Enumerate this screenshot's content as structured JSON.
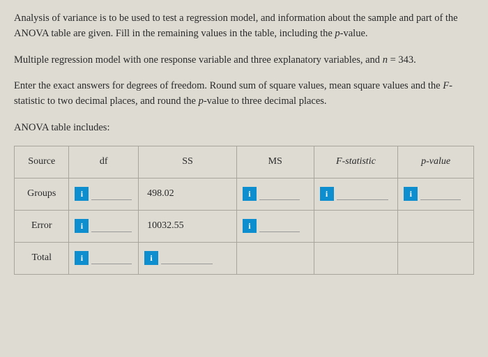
{
  "para1_a": "Analysis of variance is to be used to test a regression model, and information about the sample and part of the ANOVA table are given. Fill in the remaining values in the table, including the ",
  "para1_b": "p",
  "para1_c": "-value.",
  "para2_a": "Multiple regression model with one response variable and three explanatory variables, and ",
  "para2_b": "n",
  "para2_c": " = 343.",
  "para3_a": "Enter the exact answers for degrees of freedom. Round sum of square values, mean square values and the ",
  "para3_b": "F",
  "para3_c": "-statistic to two decimal places, and round the ",
  "para3_d": "p",
  "para3_e": "-value to three decimal places.",
  "subhead": "ANOVA table includes:",
  "headers": {
    "source": "Source",
    "df": "df",
    "ss": "SS",
    "ms": "MS",
    "f": "F-statistic",
    "p": "p-value"
  },
  "rows": {
    "groups": "Groups",
    "error": "Error",
    "total": "Total"
  },
  "values": {
    "ss_groups": "498.02",
    "ss_error": "10032.55"
  },
  "info_glyph": "i"
}
